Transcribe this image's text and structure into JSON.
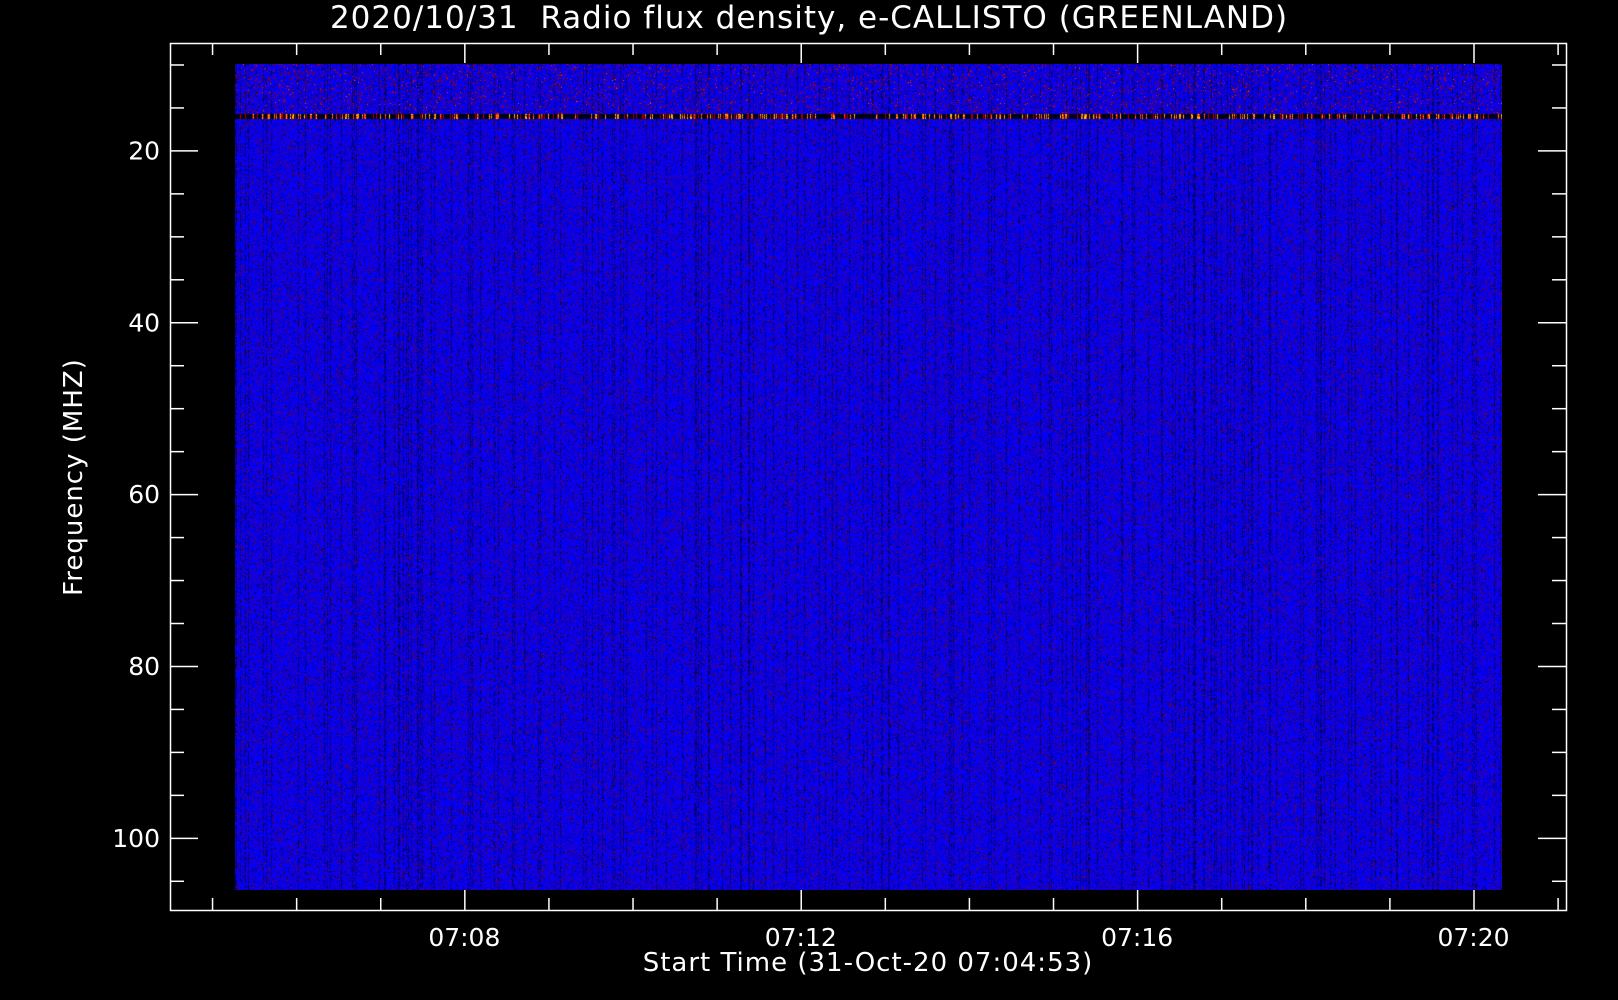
{
  "chart_data": {
    "type": "heatmap",
    "title": "2020/10/31  Radio flux density, e-CALLISTO (GREENLAND)",
    "xlabel": "Start Time (31-Oct-20 07:04:53)",
    "ylabel": "Frequency (MHZ)",
    "x_ticks": [
      "07:08",
      "07:12",
      "07:16",
      "07:20"
    ],
    "x_tick_minutes": [
      8,
      12,
      16,
      20
    ],
    "x_range_minutes_after_0700": [
      4.5,
      21.1
    ],
    "data_time_range": [
      "07:05:14",
      "07:20:19"
    ],
    "y_ticks": [
      20,
      40,
      60,
      80,
      100
    ],
    "y_range": [
      7.5,
      108.4
    ],
    "y_inverted": true,
    "data_freq_range": [
      10,
      106
    ],
    "colormap": [
      "#000000",
      "#0000ff",
      "#8b0000",
      "#ff0000",
      "#ffff00"
    ],
    "features": [
      {
        "description_freq_mhz": 16,
        "type": "persistent narrow band with bright bursts"
      }
    ],
    "grid": false,
    "background": "#000000",
    "axis_color": "#ffffff"
  }
}
